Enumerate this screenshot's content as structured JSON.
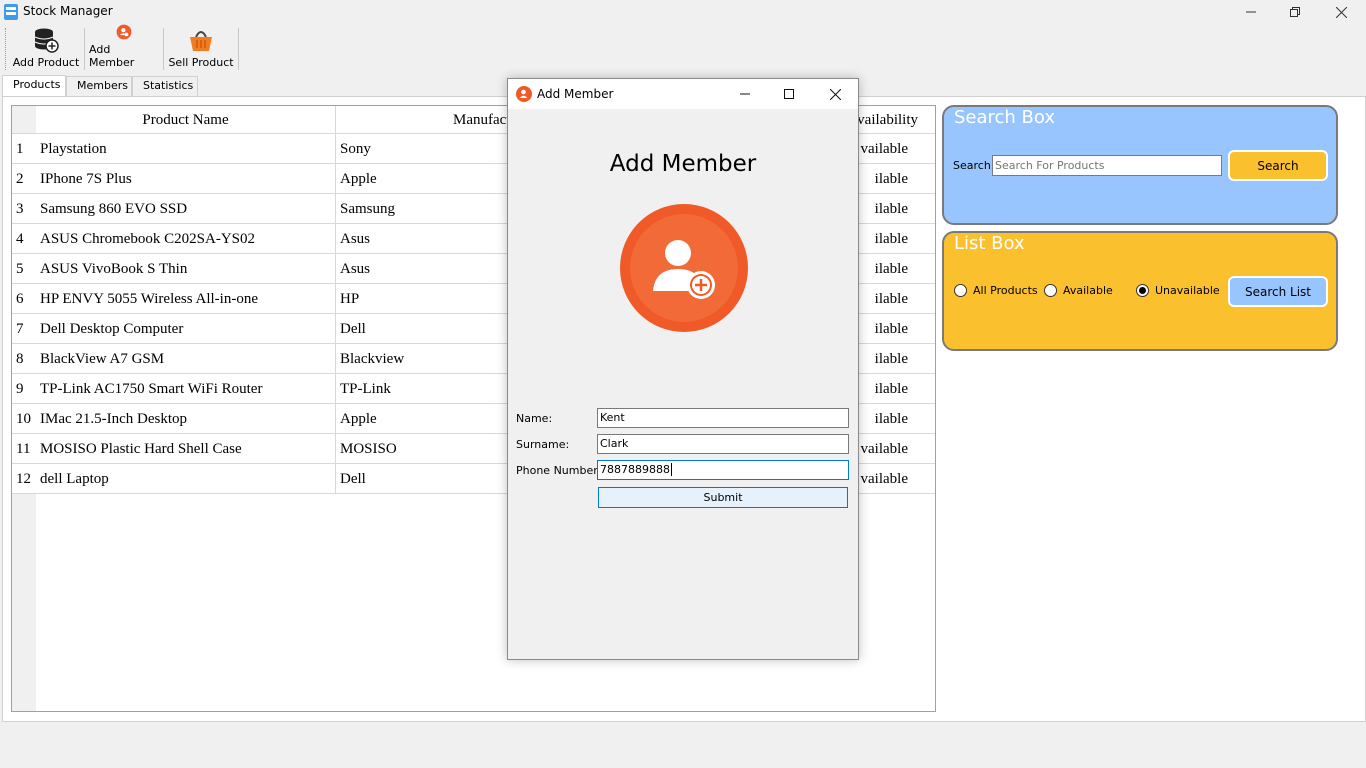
{
  "window": {
    "title": "Stock Manager"
  },
  "toolbar": {
    "add_product": "Add Product",
    "add_member": "Add Member",
    "sell_product": "Sell Product"
  },
  "tabs": [
    {
      "label": "Products",
      "active": true
    },
    {
      "label": "Members",
      "active": false
    },
    {
      "label": "Statistics",
      "active": false
    }
  ],
  "table": {
    "headers": [
      "Product Name",
      "Manufactu",
      "Availability"
    ],
    "rows": [
      {
        "num": "1",
        "name": "Playstation",
        "manufacturer": "Sony",
        "availability": "vailable"
      },
      {
        "num": "2",
        "name": "IPhone 7S Plus",
        "manufacturer": "Apple",
        "availability": "ilable"
      },
      {
        "num": "3",
        "name": "Samsung 860 EVO SSD",
        "manufacturer": "Samsung",
        "availability": "ilable"
      },
      {
        "num": "4",
        "name": "ASUS Chromebook C202SA-YS02",
        "manufacturer": "Asus",
        "availability": "ilable"
      },
      {
        "num": "5",
        "name": "ASUS VivoBook S Thin",
        "manufacturer": "Asus",
        "availability": "ilable"
      },
      {
        "num": "6",
        "name": "HP ENVY 5055 Wireless All-in-one",
        "manufacturer": "HP",
        "availability": "ilable"
      },
      {
        "num": "7",
        "name": "Dell Desktop Computer",
        "manufacturer": "Dell",
        "availability": "ilable"
      },
      {
        "num": "8",
        "name": "BlackView A7 GSM",
        "manufacturer": "Blackview",
        "availability": "ilable"
      },
      {
        "num": "9",
        "name": "TP-Link AC1750 Smart WiFi Router",
        "manufacturer": "TP-Link",
        "availability": "ilable"
      },
      {
        "num": "10",
        "name": "IMac 21.5-Inch Desktop",
        "manufacturer": "Apple",
        "availability": "ilable"
      },
      {
        "num": "11",
        "name": "MOSISO Plastic Hard Shell Case",
        "manufacturer": "MOSISO",
        "availability": "vailable"
      },
      {
        "num": "12",
        "name": "dell Laptop",
        "manufacturer": "Dell",
        "availability": "vailable"
      }
    ]
  },
  "search_box": {
    "title": "Search Box",
    "label": "Search",
    "placeholder": "Search For Products",
    "button": "Search"
  },
  "list_box": {
    "title": "List Box",
    "options": [
      "All Products",
      "Available",
      "Unavailable"
    ],
    "selected": "Unavailable",
    "button": "Search List"
  },
  "dialog": {
    "title": "Add Member",
    "heading": "Add Member",
    "name_label": "Name:",
    "name_value": "Kent",
    "surname_label": "Surname:",
    "surname_value": "Clark",
    "phone_label": "Phone Number:",
    "phone_value": "7887889888",
    "submit": "Submit"
  },
  "colors": {
    "search_box_bg": "#99c5ff",
    "list_box_bg": "#fbc02d",
    "accent_orange": "#f05a28",
    "search_button": "#fbc02d",
    "search_list_button": "#99c5ff"
  }
}
